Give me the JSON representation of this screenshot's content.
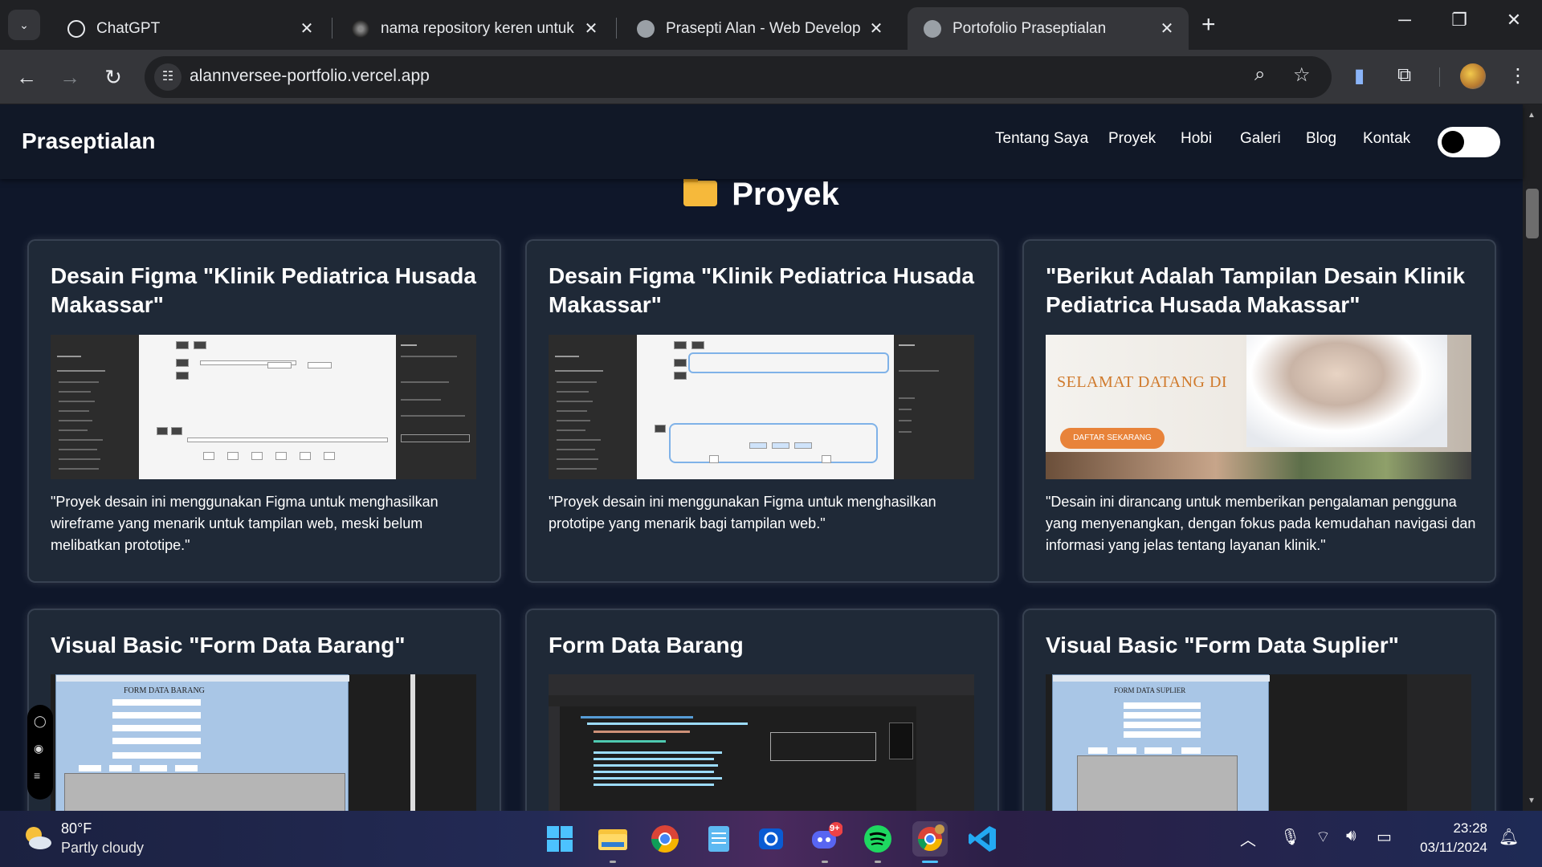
{
  "browser": {
    "tabs": [
      {
        "title": "ChatGPT",
        "active": false
      },
      {
        "title": "nama repository keren untuk portofolio",
        "active": false
      },
      {
        "title": "Prasepti Alan - Web Developer",
        "active": false
      },
      {
        "title": "Portofolio Praseptialan",
        "active": true
      }
    ],
    "url": "alannversee-portfolio.vercel.app"
  },
  "site": {
    "brand": "Praseptialan",
    "nav": [
      "Tentang Saya",
      "Proyek",
      "Hobi",
      "Galeri",
      "Blog",
      "Kontak"
    ],
    "theme_toggle": "dark",
    "section_title": "Proyek",
    "cards": [
      {
        "title": "Desain Figma \"Klinik Pediatrica Husada Makassar\"",
        "desc": "\"Proyek desain ini menggunakan Figma untuk menghasilkan wireframe yang menarik untuk tampilan web, meski belum melibatkan prototipe.\""
      },
      {
        "title": "Desain Figma \"Klinik Pediatrica Husada Makassar\"",
        "desc": "\"Proyek desain ini menggunakan Figma untuk menghasilkan prototipe yang menarik bagi tampilan web.\""
      },
      {
        "title": "\"Berikut Adalah Tampilan Desain Klinik Pediatrica Husada Makassar\"",
        "desc": "\"Desain ini dirancang untuk memberikan pengalaman pengguna yang menyenangkan, dengan fokus pada kemudahan navigasi dan informasi yang jelas tentang layanan klinik.\"",
        "hero_text": "SELAMAT DATANG DI",
        "hero_button": "DAFTAR SEKARANG"
      },
      {
        "title": "Visual Basic \"Form Data Barang\"",
        "form_title": "FORM DATA BARANG"
      },
      {
        "title": "Form Data Barang"
      },
      {
        "title": "Visual Basic \"Form Data Suplier\"",
        "form_title": "FORM DATA SUPLIER"
      }
    ]
  },
  "taskbar": {
    "temp": "80°F",
    "weather": "Partly cloudy",
    "discord_badge": "9+",
    "time": "23:28",
    "date": "03/11/2024"
  },
  "colors": {
    "page_bg": "#0f172a",
    "card_bg": "#1f2937",
    "navbar_bg": "#111827",
    "accent_folder": "#f6b93b"
  }
}
